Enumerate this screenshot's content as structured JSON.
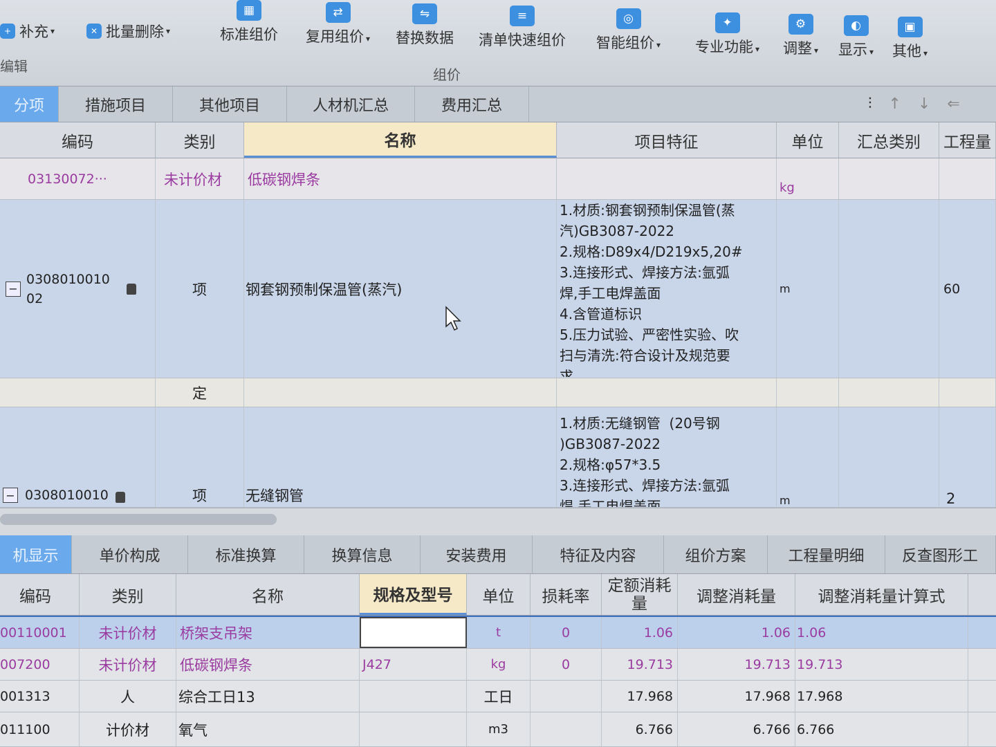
{
  "toolbar": {
    "items": [
      {
        "label": "补充",
        "icon": "add-icon"
      },
      {
        "label": "批量删除",
        "icon": "batch-delete-icon"
      },
      {
        "label": "标准组价",
        "icon": "standard-pricing-icon"
      },
      {
        "label": "复用组价",
        "icon": "reuse-pricing-icon"
      },
      {
        "label": "替换数据",
        "icon": "replace-data-icon"
      },
      {
        "label": "清单快速组价",
        "icon": "quick-pricing-icon"
      },
      {
        "label": "智能组价",
        "icon": "smart-pricing-icon"
      },
      {
        "label": "专业功能",
        "icon": "professional-icon"
      },
      {
        "label": "调整",
        "icon": "adjust-icon"
      },
      {
        "label": "显示",
        "icon": "display-icon"
      },
      {
        "label": "其他",
        "icon": "other-icon"
      }
    ],
    "group_edit": "编辑",
    "group_pricing": "组价"
  },
  "top_tabs": [
    "分项",
    "措施项目",
    "其他项目",
    "人材机汇总",
    "费用汇总"
  ],
  "grid": {
    "headers": [
      "编码",
      "类别",
      "名称",
      "项目特征",
      "单位",
      "汇总类别",
      "工程量"
    ],
    "rows": [
      {
        "code": "03130072···",
        "type": "未计价材",
        "name": "低碳钢焊条",
        "feature": "",
        "unit": "kg",
        "qty": ""
      },
      {
        "code": "0308010010\n02",
        "type": "项",
        "name": "钢套钢预制保温管(蒸汽)",
        "feature": "1.材质:钢套钢预制保温管(蒸\n汽)GB3087-2022\n2.规格:D89x4/D219x5,20#\n3.连接形式、焊接方法:氩弧\n焊,手工电焊盖面\n4.含管道标识\n5.压力试验、严密性实验、吹\n扫与清洗:符合设计及规范要\n求",
        "unit": "m",
        "qty": "60"
      },
      {
        "code": "",
        "type": "定",
        "name": "",
        "feature": "",
        "unit": "",
        "qty": ""
      },
      {
        "code": "0308010010",
        "type": "项",
        "name": "无缝钢管",
        "feature": "1.材质:无缝钢管  (20号钢\n)GB3087-2022\n2.规格:φ57*3.5\n3.连接形式、焊接方法:氩弧\n焊,手工电焊盖面",
        "unit": "m",
        "qty": "2"
      }
    ]
  },
  "bottom_tabs": [
    "机显示",
    "单价构成",
    "标准换算",
    "换算信息",
    "安装费用",
    "特征及内容",
    "组价方案",
    "工程量明细",
    "反查图形工"
  ],
  "bottom_grid": {
    "headers": [
      "编码",
      "类别",
      "名称",
      "规格及型号",
      "单位",
      "损耗率",
      "定额消耗\n量",
      "调整消耗量",
      "调整消耗量计算式"
    ],
    "rows": [
      {
        "code": "00110001",
        "type": "未计价材",
        "name": "桥架支吊架",
        "spec": "",
        "unit": "t",
        "loss": "0",
        "quota": "1.06",
        "adj": "1.06",
        "formula": "1.06"
      },
      {
        "code": "007200",
        "type": "未计价材",
        "name": "低碳钢焊条",
        "spec": "J427",
        "unit": "kg",
        "loss": "0",
        "quota": "19.713",
        "adj": "19.713",
        "formula": "19.713"
      },
      {
        "code": "001313",
        "type": "人",
        "name": "综合工日13",
        "spec": "",
        "unit": "工日",
        "loss": "",
        "quota": "17.968",
        "adj": "17.968",
        "formula": "17.968"
      },
      {
        "code": "011100",
        "type": "计价材",
        "name": "氧气",
        "spec": "",
        "unit": "m3",
        "loss": "",
        "quota": "6.766",
        "adj": "6.766",
        "formula": "6.766"
      }
    ]
  }
}
